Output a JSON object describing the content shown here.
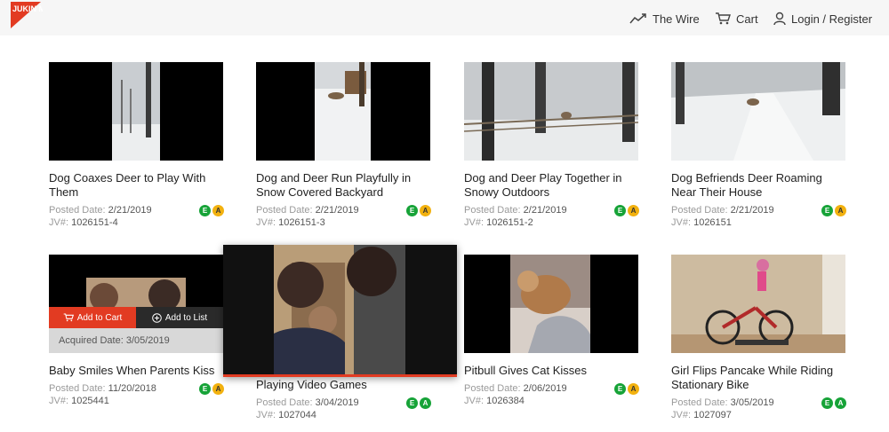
{
  "header": {
    "logo_text": "JUKIN MEDIA",
    "nav": [
      {
        "label": "The Wire",
        "icon": "trend-icon"
      },
      {
        "label": "Cart",
        "icon": "cart-icon"
      },
      {
        "label": "Login / Register",
        "icon": "user-icon"
      }
    ]
  },
  "colors": {
    "accent": "#e23b22",
    "badge_e": "#17a338",
    "badge_a": "#f2b10f"
  },
  "cards": [
    {
      "title": "Dog Coaxes Deer to Play With Them",
      "posted_label": "Posted Date:",
      "posted": "2/21/2019",
      "jv_label": "JV#:",
      "jv": "1026151-4",
      "badges": [
        "E",
        "A"
      ]
    },
    {
      "title": "Dog and Deer Run Playfully in Snow Covered Backyard",
      "posted_label": "Posted Date:",
      "posted": "2/21/2019",
      "jv_label": "JV#:",
      "jv": "1026151-3",
      "badges": [
        "E",
        "A"
      ]
    },
    {
      "title": "Dog and Deer Play Together in Snowy Outdoors",
      "posted_label": "Posted Date:",
      "posted": "2/21/2019",
      "jv_label": "JV#:",
      "jv": "1026151-2",
      "badges": [
        "E",
        "A"
      ]
    },
    {
      "title": "Dog Befriends Deer Roaming Near Their House",
      "posted_label": "Posted Date:",
      "posted": "2/21/2019",
      "jv_label": "JV#:",
      "jv": "1026151",
      "badges": [
        "E",
        "A"
      ]
    },
    {
      "title": "Baby Smiles When Parents Kiss",
      "posted_label": "Posted Date:",
      "posted": "11/20/2018",
      "jv_label": "JV#:",
      "jv": "1025441",
      "badges": [
        "E",
        "A"
      ],
      "add_to_cart": "Add to Cart",
      "add_to_list": "Add to List",
      "acquired_label": "Acquired Date:",
      "acquired": "3/05/2019"
    },
    {
      "title": "Playing Video Games",
      "posted_label": "Posted Date:",
      "posted": "3/04/2019",
      "jv_label": "JV#:",
      "jv": "1027044",
      "badges": [
        "E",
        "A"
      ]
    },
    {
      "title": "Pitbull Gives Cat Kisses",
      "posted_label": "Posted Date:",
      "posted": "2/06/2019",
      "jv_label": "JV#:",
      "jv": "1026384",
      "badges": [
        "E",
        "A"
      ]
    },
    {
      "title": "Girl Flips Pancake While Riding Stationary Bike",
      "posted_label": "Posted Date:",
      "posted": "3/05/2019",
      "jv_label": "JV#:",
      "jv": "1027097",
      "badges": [
        "E",
        "A"
      ]
    }
  ]
}
